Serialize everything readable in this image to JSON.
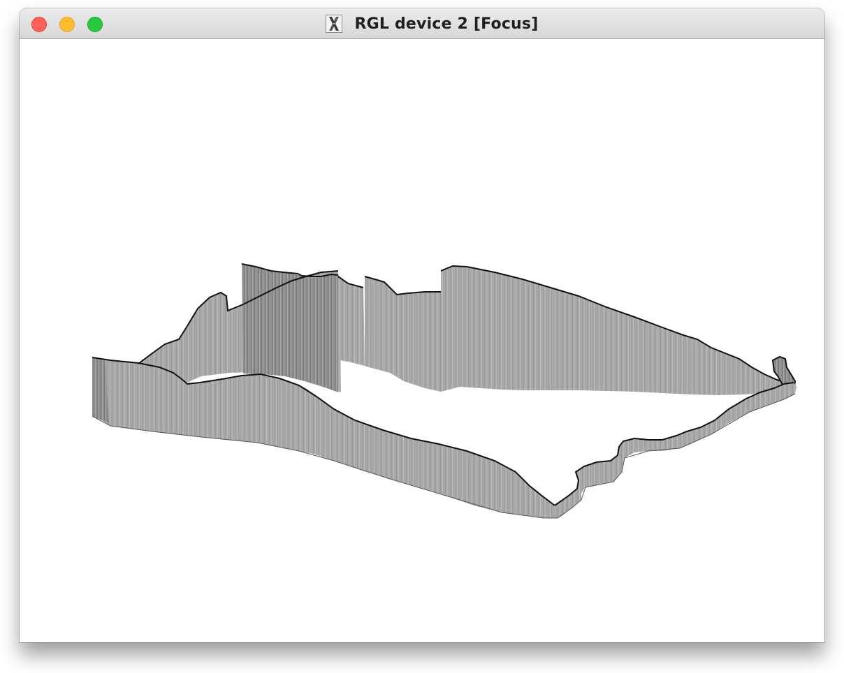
{
  "window": {
    "title": "RGL device 2 [Focus]",
    "app_icon": "x11-icon"
  },
  "traffic_lights": [
    {
      "name": "close",
      "color": "#fe5f57"
    },
    {
      "name": "minimize",
      "color": "#febc2e"
    },
    {
      "name": "zoom",
      "color": "#28c840"
    }
  ],
  "scene": {
    "content": "3d-extruded-outline",
    "wall_color": "#a9a9a9",
    "edge_color": "#111111",
    "background": "#ffffff"
  }
}
